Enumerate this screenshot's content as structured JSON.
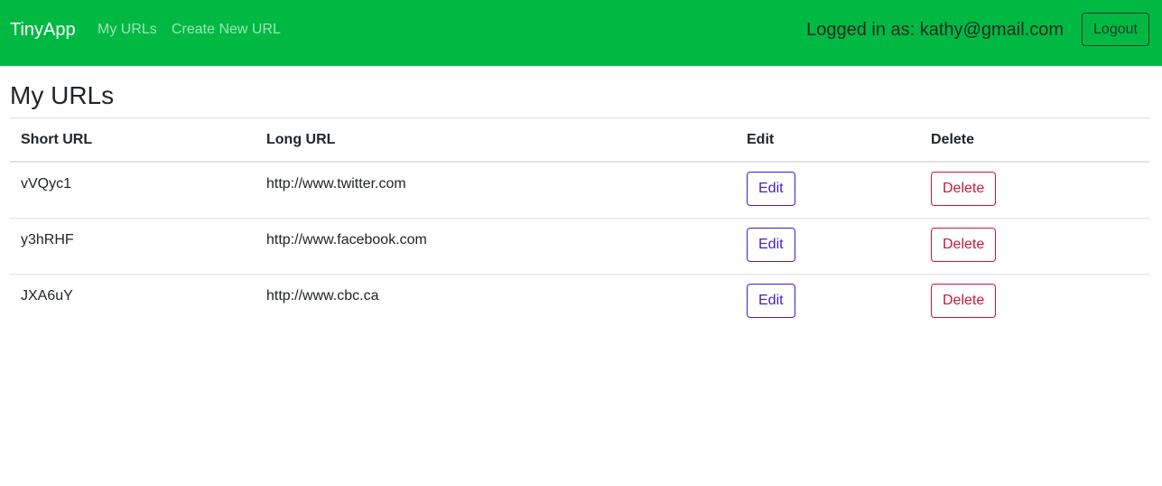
{
  "navbar": {
    "brand": "TinyApp",
    "links": [
      "My URLs",
      "Create New URL"
    ],
    "logged_in_text": "Logged in as: kathy@gmail.com",
    "logout_label": "Logout",
    "background_color": "#00b943"
  },
  "main": {
    "title": "My URLs",
    "table": {
      "headers": [
        "Short URL",
        "Long URL",
        "Edit",
        "Delete"
      ],
      "rows": [
        {
          "short": "vVQyc1",
          "long": "http://www.twitter.com",
          "edit": "Edit",
          "delete": "Delete"
        },
        {
          "short": "y3hRHF",
          "long": "http://www.facebook.com",
          "edit": "Edit",
          "delete": "Delete"
        },
        {
          "short": "JXA6uY",
          "long": "http://www.cbc.ca",
          "edit": "Edit",
          "delete": "Delete"
        }
      ]
    }
  }
}
